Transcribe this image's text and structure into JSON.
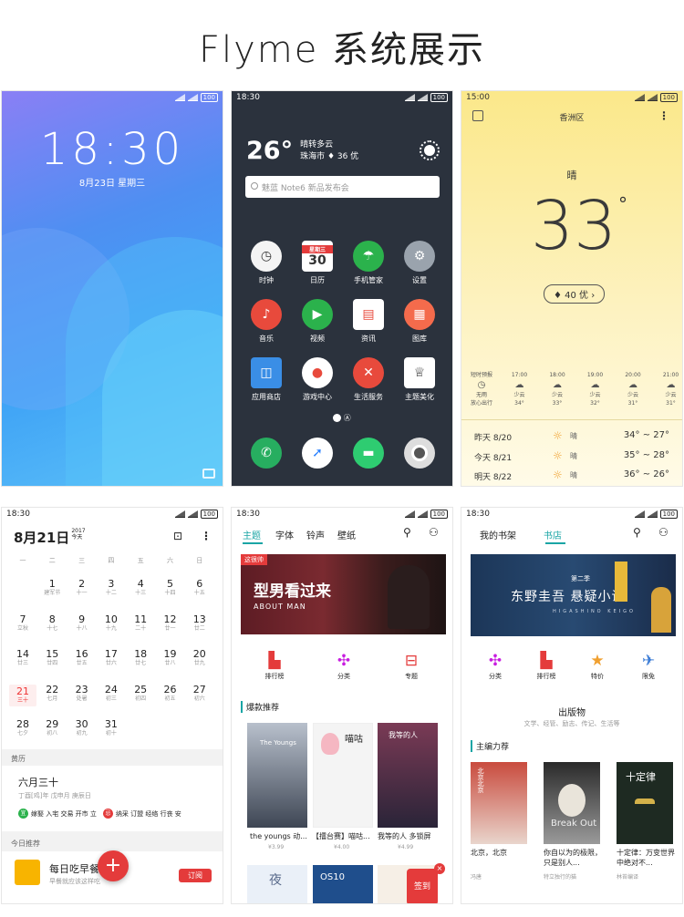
{
  "page_title": "Flyme 系统展示",
  "lockscreen": {
    "status_battery": "100",
    "time": "18:30",
    "date": "8月23日  星期三"
  },
  "home": {
    "status_time": "18:30",
    "status_battery": "100",
    "temperature": "26°",
    "weather_line1": "晴转多云",
    "weather_line2": "珠海市 ♦ 36 优",
    "search_placeholder": "魅蓝 Note6 新品发布会",
    "apps": [
      "时钟",
      "日历",
      "手机管家",
      "设置",
      "音乐",
      "视频",
      "资讯",
      "图库",
      "应用商店",
      "游戏中心",
      "生活服务",
      "主题美化"
    ],
    "calendar_icon_top": "星期三",
    "calendar_icon_day": "30",
    "page_indicator": "Ⓐ"
  },
  "weather": {
    "status_time": "15:00",
    "status_battery": "100",
    "location": "香洲区",
    "condition": "晴",
    "temperature": "33",
    "aqi": "♦ 40 优 ›",
    "hourly": [
      {
        "time": "短时预报",
        "cond": "无雨",
        "temp": "放心出行"
      },
      {
        "time": "17:00",
        "cond": "少云",
        "temp": "34°"
      },
      {
        "time": "18:00",
        "cond": "少云",
        "temp": "33°"
      },
      {
        "time": "19:00",
        "cond": "少云",
        "temp": "32°"
      },
      {
        "time": "20:00",
        "cond": "少云",
        "temp": "31°"
      },
      {
        "time": "21:00",
        "cond": "少云",
        "temp": "31°"
      }
    ],
    "daily": [
      {
        "day": "昨天  8/20",
        "cond": "晴",
        "temp": "34° ~ 27°"
      },
      {
        "day": "今天  8/21",
        "cond": "晴",
        "temp": "35° ~ 28°"
      },
      {
        "day": "明天  8/22",
        "cond": "晴",
        "temp": "36° ~ 26°"
      }
    ]
  },
  "calendar": {
    "status_time": "18:30",
    "status_battery": "100",
    "month_day": "8月21日",
    "year": "2017",
    "today_label": "今天",
    "weekdays": [
      "一",
      "二",
      "三",
      "四",
      "五",
      "六",
      "日"
    ],
    "weeks": [
      [
        {
          "d": "1",
          "l": "建军节"
        },
        {
          "d": "2",
          "l": "十一"
        },
        {
          "d": "3",
          "l": "十二"
        },
        {
          "d": "4",
          "l": "十三"
        },
        {
          "d": "5",
          "l": "十四"
        },
        {
          "d": "6",
          "l": "十五"
        }
      ],
      [
        {
          "d": "7",
          "l": "立秋"
        },
        {
          "d": "8",
          "l": "十七"
        },
        {
          "d": "9",
          "l": "十八"
        },
        {
          "d": "10",
          "l": "十九"
        },
        {
          "d": "11",
          "l": "二十"
        },
        {
          "d": "12",
          "l": "廿一"
        },
        {
          "d": "13",
          "l": "廿二"
        }
      ],
      [
        {
          "d": "14",
          "l": "廿三"
        },
        {
          "d": "15",
          "l": "廿四"
        },
        {
          "d": "16",
          "l": "廿五"
        },
        {
          "d": "17",
          "l": "廿六"
        },
        {
          "d": "18",
          "l": "廿七"
        },
        {
          "d": "19",
          "l": "廿八"
        },
        {
          "d": "20",
          "l": "廿九"
        }
      ],
      [
        {
          "d": "21",
          "l": "三十"
        },
        {
          "d": "22",
          "l": "七月"
        },
        {
          "d": "23",
          "l": "处暑"
        },
        {
          "d": "24",
          "l": "初三"
        },
        {
          "d": "25",
          "l": "初四"
        },
        {
          "d": "26",
          "l": "初五"
        },
        {
          "d": "27",
          "l": "初六"
        }
      ],
      [
        {
          "d": "28",
          "l": "七夕"
        },
        {
          "d": "29",
          "l": "初八"
        },
        {
          "d": "30",
          "l": "初九"
        },
        {
          "d": "31",
          "l": "初十"
        }
      ]
    ],
    "almanac_label": "黄历",
    "lunar_date": "六月三十",
    "ganzhi": "丁酉[鸡]年  戊申月  庚辰日",
    "yi_label": "宜",
    "yi": "嫁娶 入宅 交易 开市 立",
    "ji_label": "忌",
    "ji": "纳采 订盟 经络 行丧 安",
    "recommend_label": "今日推荐",
    "rec_title": "每日吃早餐",
    "rec_sub": "早餐就应该这样吃",
    "fab": "+",
    "subscribe": "订阅"
  },
  "themes": {
    "status_time": "18:30",
    "status_battery": "100",
    "tabs": [
      "主题",
      "字体",
      "铃声",
      "壁纸"
    ],
    "banner_tag": "这很帅",
    "banner_title": "型男看过来",
    "banner_en": "ABOUT MAN",
    "categories": [
      "排行榜",
      "分类",
      "专题"
    ],
    "hot_label": "爆款推荐",
    "cards": [
      {
        "title": "the youngs 动...",
        "price": "¥3.99"
      },
      {
        "title": "【擂台赛】喵咕...",
        "price": "¥4.00"
      },
      {
        "title": "我等的人 多锁屏",
        "price": "¥4.99"
      }
    ],
    "card_texts": [
      "The Youngs",
      "喵咕",
      "我等的人"
    ],
    "bottom_texts": [
      "夜",
      "OS10",
      "签到"
    ],
    "badge_x": "×"
  },
  "books": {
    "status_time": "18:30",
    "status_battery": "100",
    "tabs": [
      "我的书架",
      "书店"
    ],
    "banner_season": "第二季",
    "banner_title": "东野圭吾 悬疑小说",
    "banner_en": "HIGASHINO KEIGO",
    "categories": [
      "分类",
      "排行榜",
      "特价",
      "限免"
    ],
    "publisher_title": "出版物",
    "publisher_sub": "文学、经管、励志、传记、生活等",
    "editor_label": "主编力荐",
    "books": [
      {
        "title": "北京，北京",
        "author": "冯唐",
        "cover": "北京北京"
      },
      {
        "title": "你自以为的极限，只是别人...",
        "author": "特立独行的猫",
        "cover": "Break Out"
      },
      {
        "title": "十定律：万变世界中绝对不...",
        "author": "林苔编译",
        "cover": "十定律"
      }
    ]
  }
}
